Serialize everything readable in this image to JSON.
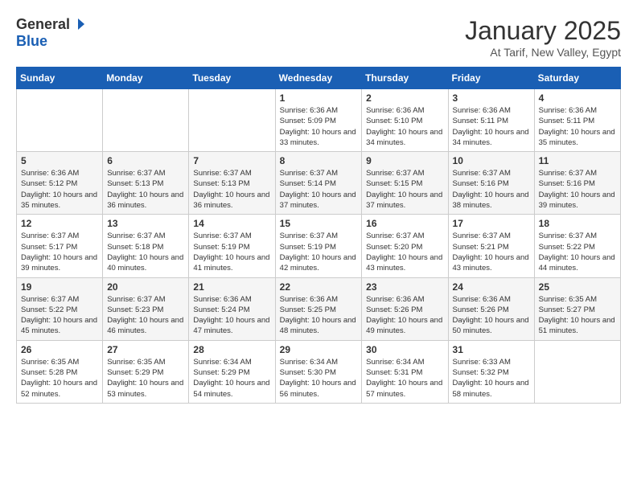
{
  "header": {
    "logo_general": "General",
    "logo_blue": "Blue",
    "month_title": "January 2025",
    "subtitle": "At Tarif, New Valley, Egypt"
  },
  "days_of_week": [
    "Sunday",
    "Monday",
    "Tuesday",
    "Wednesday",
    "Thursday",
    "Friday",
    "Saturday"
  ],
  "weeks": [
    [
      {
        "day": "",
        "info": ""
      },
      {
        "day": "",
        "info": ""
      },
      {
        "day": "",
        "info": ""
      },
      {
        "day": "1",
        "info": "Sunrise: 6:36 AM\nSunset: 5:09 PM\nDaylight: 10 hours\nand 33 minutes."
      },
      {
        "day": "2",
        "info": "Sunrise: 6:36 AM\nSunset: 5:10 PM\nDaylight: 10 hours\nand 34 minutes."
      },
      {
        "day": "3",
        "info": "Sunrise: 6:36 AM\nSunset: 5:11 PM\nDaylight: 10 hours\nand 34 minutes."
      },
      {
        "day": "4",
        "info": "Sunrise: 6:36 AM\nSunset: 5:11 PM\nDaylight: 10 hours\nand 35 minutes."
      }
    ],
    [
      {
        "day": "5",
        "info": "Sunrise: 6:36 AM\nSunset: 5:12 PM\nDaylight: 10 hours\nand 35 minutes."
      },
      {
        "day": "6",
        "info": "Sunrise: 6:37 AM\nSunset: 5:13 PM\nDaylight: 10 hours\nand 36 minutes."
      },
      {
        "day": "7",
        "info": "Sunrise: 6:37 AM\nSunset: 5:13 PM\nDaylight: 10 hours\nand 36 minutes."
      },
      {
        "day": "8",
        "info": "Sunrise: 6:37 AM\nSunset: 5:14 PM\nDaylight: 10 hours\nand 37 minutes."
      },
      {
        "day": "9",
        "info": "Sunrise: 6:37 AM\nSunset: 5:15 PM\nDaylight: 10 hours\nand 37 minutes."
      },
      {
        "day": "10",
        "info": "Sunrise: 6:37 AM\nSunset: 5:16 PM\nDaylight: 10 hours\nand 38 minutes."
      },
      {
        "day": "11",
        "info": "Sunrise: 6:37 AM\nSunset: 5:16 PM\nDaylight: 10 hours\nand 39 minutes."
      }
    ],
    [
      {
        "day": "12",
        "info": "Sunrise: 6:37 AM\nSunset: 5:17 PM\nDaylight: 10 hours\nand 39 minutes."
      },
      {
        "day": "13",
        "info": "Sunrise: 6:37 AM\nSunset: 5:18 PM\nDaylight: 10 hours\nand 40 minutes."
      },
      {
        "day": "14",
        "info": "Sunrise: 6:37 AM\nSunset: 5:19 PM\nDaylight: 10 hours\nand 41 minutes."
      },
      {
        "day": "15",
        "info": "Sunrise: 6:37 AM\nSunset: 5:19 PM\nDaylight: 10 hours\nand 42 minutes."
      },
      {
        "day": "16",
        "info": "Sunrise: 6:37 AM\nSunset: 5:20 PM\nDaylight: 10 hours\nand 43 minutes."
      },
      {
        "day": "17",
        "info": "Sunrise: 6:37 AM\nSunset: 5:21 PM\nDaylight: 10 hours\nand 43 minutes."
      },
      {
        "day": "18",
        "info": "Sunrise: 6:37 AM\nSunset: 5:22 PM\nDaylight: 10 hours\nand 44 minutes."
      }
    ],
    [
      {
        "day": "19",
        "info": "Sunrise: 6:37 AM\nSunset: 5:22 PM\nDaylight: 10 hours\nand 45 minutes."
      },
      {
        "day": "20",
        "info": "Sunrise: 6:37 AM\nSunset: 5:23 PM\nDaylight: 10 hours\nand 46 minutes."
      },
      {
        "day": "21",
        "info": "Sunrise: 6:36 AM\nSunset: 5:24 PM\nDaylight: 10 hours\nand 47 minutes."
      },
      {
        "day": "22",
        "info": "Sunrise: 6:36 AM\nSunset: 5:25 PM\nDaylight: 10 hours\nand 48 minutes."
      },
      {
        "day": "23",
        "info": "Sunrise: 6:36 AM\nSunset: 5:26 PM\nDaylight: 10 hours\nand 49 minutes."
      },
      {
        "day": "24",
        "info": "Sunrise: 6:36 AM\nSunset: 5:26 PM\nDaylight: 10 hours\nand 50 minutes."
      },
      {
        "day": "25",
        "info": "Sunrise: 6:35 AM\nSunset: 5:27 PM\nDaylight: 10 hours\nand 51 minutes."
      }
    ],
    [
      {
        "day": "26",
        "info": "Sunrise: 6:35 AM\nSunset: 5:28 PM\nDaylight: 10 hours\nand 52 minutes."
      },
      {
        "day": "27",
        "info": "Sunrise: 6:35 AM\nSunset: 5:29 PM\nDaylight: 10 hours\nand 53 minutes."
      },
      {
        "day": "28",
        "info": "Sunrise: 6:34 AM\nSunset: 5:29 PM\nDaylight: 10 hours\nand 54 minutes."
      },
      {
        "day": "29",
        "info": "Sunrise: 6:34 AM\nSunset: 5:30 PM\nDaylight: 10 hours\nand 56 minutes."
      },
      {
        "day": "30",
        "info": "Sunrise: 6:34 AM\nSunset: 5:31 PM\nDaylight: 10 hours\nand 57 minutes."
      },
      {
        "day": "31",
        "info": "Sunrise: 6:33 AM\nSunset: 5:32 PM\nDaylight: 10 hours\nand 58 minutes."
      },
      {
        "day": "",
        "info": ""
      }
    ]
  ]
}
